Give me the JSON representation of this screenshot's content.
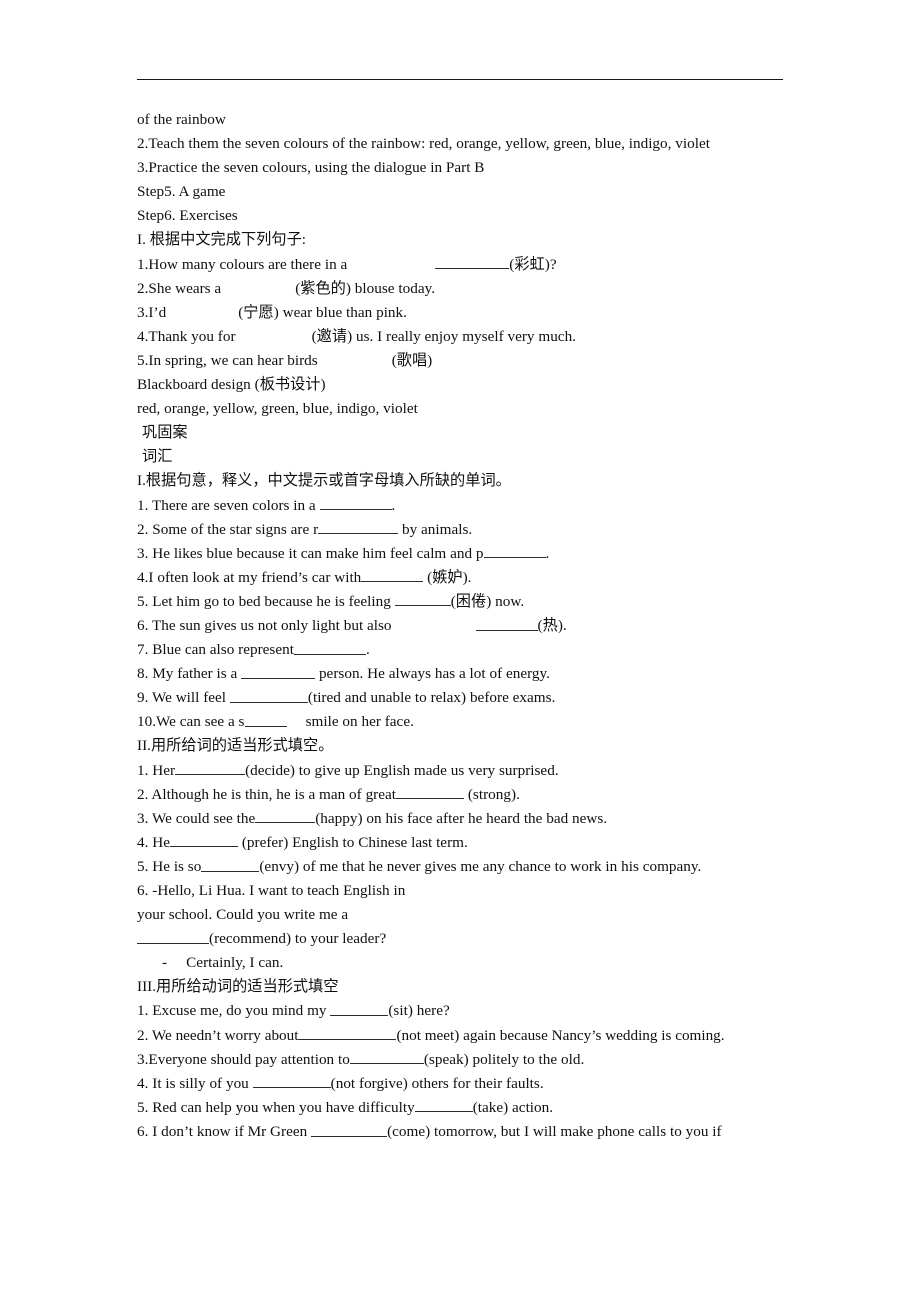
{
  "document": {
    "type": "lesson-plan-worksheet",
    "header_rule": true,
    "lines": [
      {
        "id": "l1",
        "text": "of the rainbow"
      },
      {
        "id": "l2",
        "text": "2.Teach them the seven colours of the rainbow: red, orange, yellow, green, blue, indigo, violet"
      },
      {
        "id": "l3",
        "text": "3.Practice the seven colours, using the dialogue in Part B"
      },
      {
        "id": "l4",
        "text": "Step5. A game"
      },
      {
        "id": "l5",
        "text": "Step6. Exercises"
      },
      {
        "id": "l6",
        "text": "I. 根据中文完成下列句子:"
      },
      {
        "id": "l7",
        "pre": "1.How many colours are there in a",
        "gap": 88,
        "blank": 74,
        "post": "(彩虹)?"
      },
      {
        "id": "l8",
        "pre": "2.She wears a",
        "gap": 74,
        "post": "(紫色的) blouse today."
      },
      {
        "id": "l9",
        "pre": "3.I’d",
        "gap": 72,
        "post": "(宁愿) wear blue than pink."
      },
      {
        "id": "l10",
        "pre": "4.Thank you for",
        "gap": 76,
        "post": "(邀请) us. I really enjoy myself very much."
      },
      {
        "id": "l11",
        "pre": "5.In spring, we can hear birds",
        "gap": 74,
        "post": "(歌唱)"
      },
      {
        "id": "l12",
        "text": "Blackboard design (板书设计)"
      },
      {
        "id": "l13",
        "text": "red, orange, yellow, green, blue, indigo, violet"
      },
      {
        "id": "l14",
        "text": "巩固案",
        "indent": "sm"
      },
      {
        "id": "l15",
        "text": "词汇",
        "indent": "sm"
      },
      {
        "id": "l16",
        "text": "I.根据句意，释义，中文提示或首字母填入所缺的单词。"
      },
      {
        "id": "l17",
        "pre": "1. There are seven colors in a ",
        "blank": 72,
        "post": "."
      },
      {
        "id": "l18",
        "pre": "2. Some of the star signs are r",
        "blank": 80,
        "post": " by animals."
      },
      {
        "id": "l19",
        "pre": "3. He likes blue because it can make him feel calm and p",
        "blank": 62,
        "post": "."
      },
      {
        "id": "l20",
        "pre": "4.I often look at my friend’s car with",
        "blank": 62,
        "post": " (嫉妒)."
      },
      {
        "id": "l21",
        "pre": "5. Let him go to bed because he is feeling ",
        "blank": 56,
        "post": "(困倦) now."
      },
      {
        "id": "l22",
        "pre": "6. The sun gives us not only light but also",
        "gap": 84,
        "blank": 62,
        "post": "(热)."
      },
      {
        "id": "l23",
        "pre": "7. Blue can also represent",
        "blank": 72,
        "post": "."
      },
      {
        "id": "l24",
        "pre": "8. My father is a ",
        "blank": 74,
        "post": " person. He always has a lot of energy."
      },
      {
        "id": "l25",
        "pre": "9. We will feel ",
        "blank": 78,
        "post": "(tired and unable to relax) before exams."
      },
      {
        "id": "l26",
        "pre": "10.We can see a s",
        "blank": 42,
        "post": "     smile on her face."
      },
      {
        "id": "l27",
        "text": "II.用所给词的适当形式填空。"
      },
      {
        "id": "l28",
        "pre": "1. Her",
        "blank": 70,
        "post": "(decide) to give up English made us very surprised."
      },
      {
        "id": "l29",
        "pre": "2. Although he is thin, he is a man of great",
        "blank": 68,
        "post": " (strong)."
      },
      {
        "id": "l30",
        "pre": "3. We could see the",
        "blank": 60,
        "post": "(happy) on his face after he heard the bad news."
      },
      {
        "id": "l31",
        "pre": "4. He",
        "blank": 68,
        "post": " (prefer) English to Chinese last term."
      },
      {
        "id": "l32",
        "pre": "5. He is so",
        "blank": 58,
        "post": "(envy) of me that he never gives me any chance to work in his company."
      },
      {
        "id": "l33",
        "text": "6. -Hello, Li Hua. I want to teach English in"
      },
      {
        "id": "l34",
        "text": "your school. Could you write me a"
      },
      {
        "id": "l35",
        "pre": "",
        "blank": 72,
        "post": "(recommend) to your leader?"
      },
      {
        "id": "l36",
        "text": "-     Certainly, I can.",
        "indent": "dash"
      },
      {
        "id": "l37",
        "text": "III.用所给动词的适当形式填空"
      },
      {
        "id": "l38",
        "pre": "1. Excuse me, do you mind my ",
        "blank": 58,
        "post": "(sit) here?"
      },
      {
        "id": "l39",
        "justified": true,
        "pre": "2. We needn’t worry about",
        "blank": 98,
        "post": "(not meet) again because Nancy’s wedding is coming."
      },
      {
        "id": "l40",
        "pre": "3.Everyone should pay attention to",
        "blank": 74,
        "post": "(speak) politely to the old."
      },
      {
        "id": "l41",
        "pre": "4. It is silly of you ",
        "blank": 78,
        "post": "(not forgive) others for their faults."
      },
      {
        "id": "l42",
        "pre": "5. Red can help you when you have difficulty",
        "blank": 58,
        "post": "(take) action."
      },
      {
        "id": "l43",
        "pre": "6. I don’t know if Mr Green ",
        "blank": 76,
        "post": "(come) tomorrow, but I will make phone calls to you if"
      }
    ]
  },
  "colors": {
    "text": "#101010",
    "rule": "#1a1a1a",
    "blank_rule": "#2b2b2b",
    "background": "#ffffff"
  }
}
